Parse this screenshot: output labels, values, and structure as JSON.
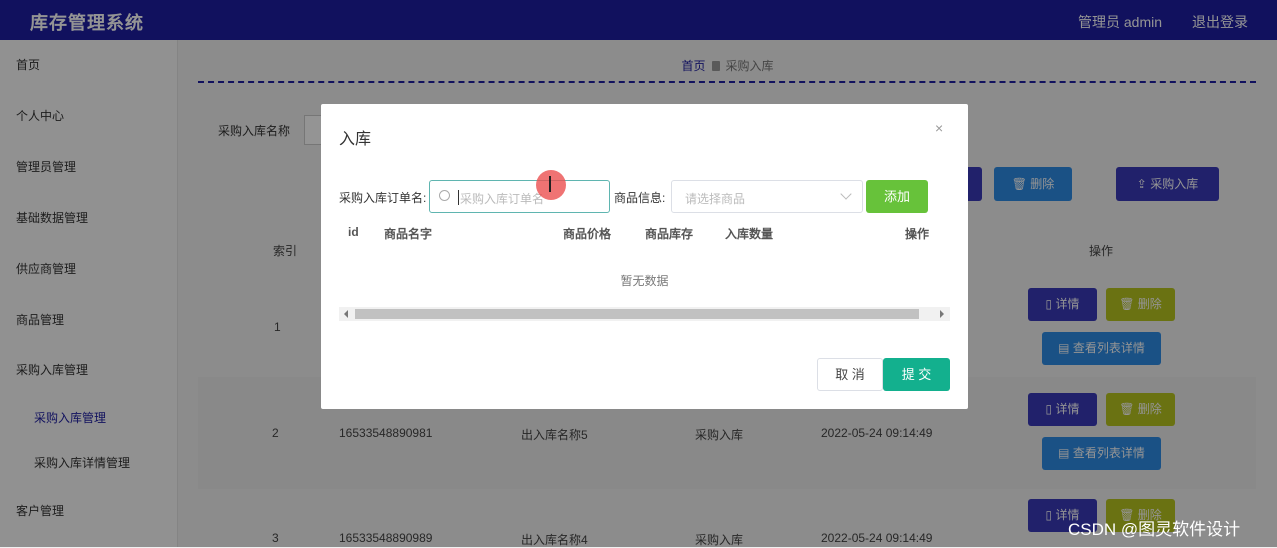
{
  "header": {
    "title": "库存管理系统",
    "admin": "管理员 admin",
    "logout": "退出登录"
  },
  "sidebar": {
    "items": [
      "首页",
      "个人中心",
      "管理员管理",
      "基础数据管理",
      "供应商管理",
      "商品管理",
      "采购入库管理",
      "采购入库管理",
      "采购入库详情管理",
      "客户管理"
    ]
  },
  "breadcrumb": {
    "home": "首页",
    "current": "采购入库"
  },
  "search": {
    "label": "采购入库名称"
  },
  "toolbar": {
    "delete": "删除",
    "purchase_in": "采购入库"
  },
  "table": {
    "headers": {
      "index": "索引",
      "actions": "操作"
    },
    "rows": [
      {
        "index": "1"
      },
      {
        "index": "2",
        "order_no": "16533548890981",
        "name": "出入库名称5",
        "type": "采购入库",
        "time": "2022-05-24 09:14:49"
      },
      {
        "index": "3",
        "order_no": "16533548890989",
        "name": "出入库名称4",
        "type": "采购入库",
        "time": "2022-05-24 09:14:49"
      }
    ],
    "actions": {
      "detail": "详情",
      "delete": "删除",
      "view_list": "查看列表详情"
    }
  },
  "modal": {
    "title": "入库",
    "close": "×",
    "order_label": "采购入库订单名:",
    "order_placeholder": "采购入库订单名",
    "goods_label": "商品信息:",
    "goods_placeholder": "请选择商品",
    "add": "添加",
    "columns": [
      "id",
      "商品名字",
      "商品价格",
      "商品库存",
      "入库数量",
      "操作"
    ],
    "empty": "暂无数据",
    "cancel": "取 消",
    "submit": "提 交"
  },
  "watermark": "CSDN @图灵软件设计",
  "colors": {
    "primary": "#1e1ea3",
    "success": "#67c23a",
    "teal": "#13b08e",
    "info": "#2e8ce6",
    "warning": "#b7c420"
  }
}
